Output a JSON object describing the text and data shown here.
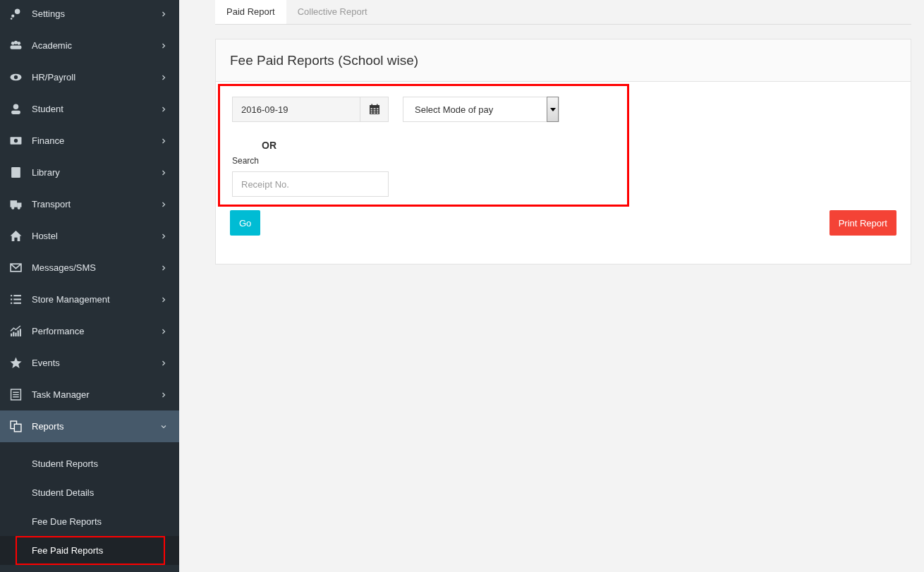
{
  "sidebar": {
    "items": [
      {
        "label": "Settings",
        "expanded": false
      },
      {
        "label": "Academic",
        "expanded": false
      },
      {
        "label": "HR/Payroll",
        "expanded": false
      },
      {
        "label": "Student",
        "expanded": false
      },
      {
        "label": "Finance",
        "expanded": false
      },
      {
        "label": "Library",
        "expanded": false
      },
      {
        "label": "Transport",
        "expanded": false
      },
      {
        "label": "Hostel",
        "expanded": false
      },
      {
        "label": "Messages/SMS",
        "expanded": false
      },
      {
        "label": "Store Management",
        "expanded": false
      },
      {
        "label": "Performance",
        "expanded": false
      },
      {
        "label": "Events",
        "expanded": false
      },
      {
        "label": "Task Manager",
        "expanded": false
      },
      {
        "label": "Reports",
        "expanded": true,
        "children": [
          {
            "label": "Student Reports",
            "selected": false,
            "highlighted": false
          },
          {
            "label": "Student Details",
            "selected": false,
            "highlighted": false
          },
          {
            "label": "Fee Due Reports",
            "selected": false,
            "highlighted": false
          },
          {
            "label": "Fee Paid Reports",
            "selected": true,
            "highlighted": true
          }
        ]
      }
    ]
  },
  "tabs": [
    {
      "label": "Paid Report",
      "selected": true
    },
    {
      "label": "Collective Report",
      "selected": false
    }
  ],
  "panel": {
    "title": "Fee Paid Reports (School wise)",
    "form": {
      "highlighted": true,
      "date": {
        "value": "2016-09-19"
      },
      "mode_select": {
        "value": "Select Mode of pay"
      },
      "or_label": "OR",
      "search_label": "Search",
      "search": {
        "placeholder": "Receipt No."
      }
    },
    "buttons": [
      {
        "label": "Go",
        "kind": "primary"
      },
      {
        "label": "Print Report",
        "kind": "danger"
      }
    ]
  }
}
